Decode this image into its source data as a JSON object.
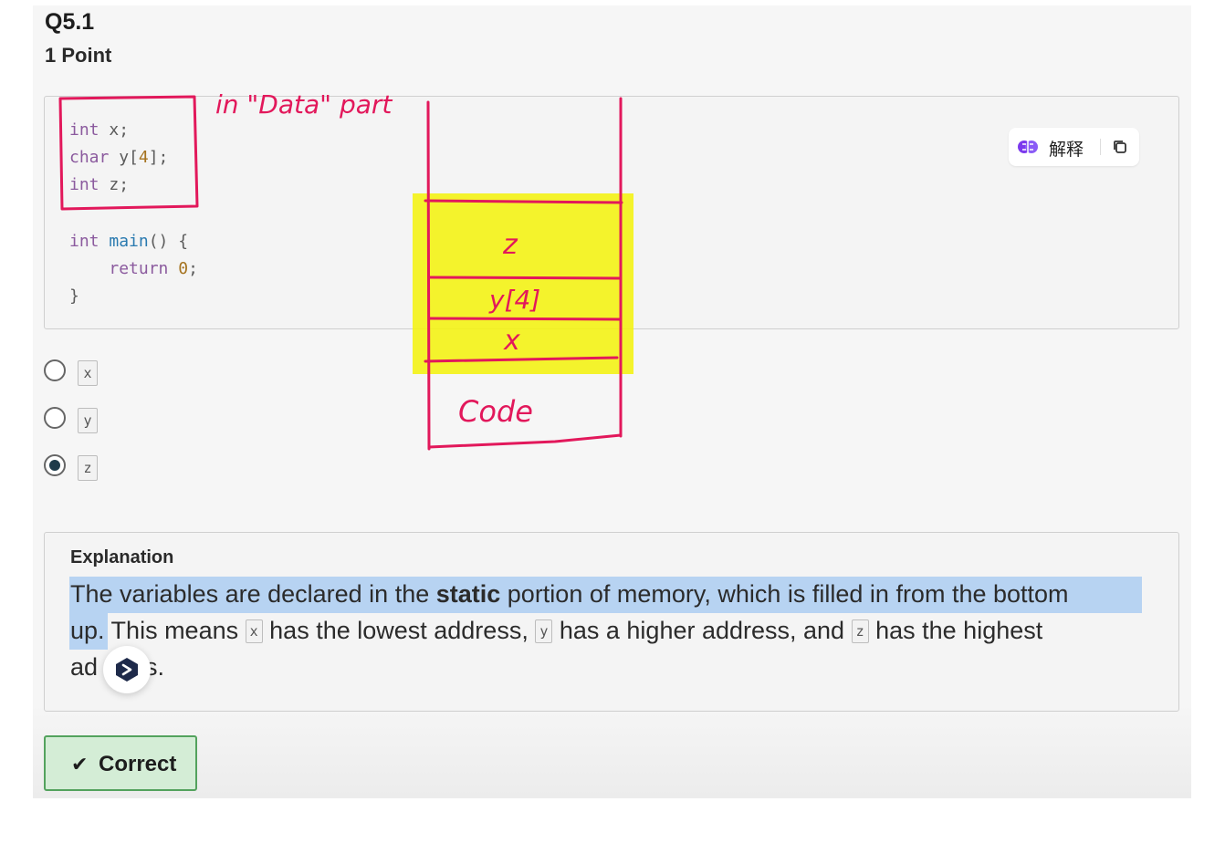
{
  "question": {
    "number": "Q5.1",
    "points": "1 Point"
  },
  "code_lines": [
    "int x;",
    "char y[4];",
    "int z;",
    "",
    "int main() {",
    "    return 0;",
    "}"
  ],
  "code_tokens": {
    "l1_kw": "int",
    "l1_rest": " x;",
    "l2_kw": "char",
    "l2_a": " y[",
    "l2_num": "4",
    "l2_b": "];",
    "l3_kw": "int",
    "l3_rest": " z;",
    "l5_kw": "int",
    "l5_fn": "main",
    "l5_rest": "() {",
    "l6_kw": "return",
    "l6_num": "0",
    "l6_rest": ";",
    "l7": "}"
  },
  "toolbar": {
    "explain_label": "解释",
    "explain_icon": "brain-icon",
    "copy_icon": "copy-icon"
  },
  "annotations": {
    "heading": "in \"Data\" part",
    "cells": [
      "z",
      "y[4]",
      "x",
      "Code"
    ],
    "ink_color": "#e2185b",
    "highlight_color": "#f3f21a"
  },
  "options": [
    {
      "label": "x",
      "selected": false
    },
    {
      "label": "y",
      "selected": false
    },
    {
      "label": "z",
      "selected": true
    }
  ],
  "explanation": {
    "heading": "Explanation",
    "l1_a": "The variables are declared in the ",
    "l1_bold": "static",
    "l1_b": " portion of memory, which is filled in from the bottom",
    "l2_a": "up.",
    "l2_b": " This means ",
    "x": "x",
    "l2_c": " has the lowest address, ",
    "y": "y",
    "l2_d": " has a higher address, and ",
    "z": "z",
    "l2_e": " has the highest",
    "l3_a": "ad",
    "l3_b": "s."
  },
  "result": {
    "label": "Correct",
    "icon": "checkmark-icon"
  },
  "colors": {
    "accent_green": "#53a25d",
    "selection_blue": "#b7d3f2",
    "radio_dark": "#1f3b4a"
  }
}
